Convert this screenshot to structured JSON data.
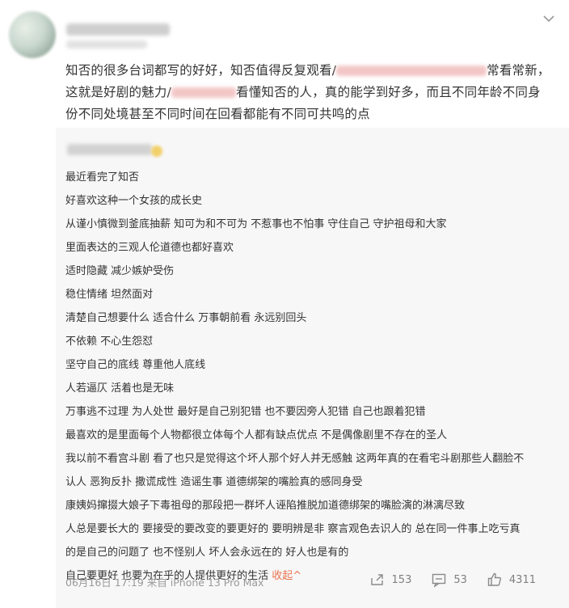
{
  "post": {
    "text_part1": "知否的很多台词都写的好好，知否值得反复观看/",
    "text_part2": "常看常新，",
    "text_part3": "这就是好剧的魅力/",
    "text_part4": "看懂知否的人，真的能学到好多，而且不同年龄不同身",
    "text_part5": "份不同处境甚至不同时间在回看都能有不同可共鸣的点"
  },
  "comment": {
    "lines": [
      "最近看完了知否",
      "好喜欢这种一个女孩的成长史",
      "从谨小慎微到釜底抽薪 知可为和不可为 不惹事也不怕事 守住自己 守护祖母和大家",
      "里面表达的三观人伦道德也都好喜欢",
      "适时隐藏 减少嫉妒受伤",
      "稳住情绪 坦然面对",
      "清楚自己想要什么 适合什么 万事朝前看 永远别回头",
      "不依赖 不心生怨怼",
      "坚守自己的底线 尊重他人底线",
      "人若逼仄 活着也是无味",
      "万事逃不过理 为人处世 最好是自己别犯错 也不要因旁人犯错 自己也跟着犯错",
      "最喜欢的是里面每个人物都很立体每个人都有缺点优点 不是偶像剧里不存在的圣人",
      "我以前不看宫斗剧 看了也只是觉得这个坏人那个好人并无感触 这两年真的在看宅斗剧那些人翻脸不",
      "认人 恶狗反扑 撒谎成性 造谣生事 道德绑架的嘴脸真的感同身受",
      "康姨妈撺掇大娘子下毒祖母的那段把一群坏人诬陷推脱加道德绑架的嘴脸演的淋漓尽致",
      "人总是要长大的 要接受的要改变的要更好的 要明辨是非 察言观色去识人的 总在同一件事上吃亏真",
      "的是自己的问题了 也不怪别人 坏人会永远在的 好人也是有的"
    ],
    "last_line": "自己要更好 也要为在乎的人提供更好的生活",
    "collapse_label": "收起^",
    "meta": "06月16日 17:19 来自 iPhone 13 Pro Max",
    "repost_count": "153",
    "comment_count": "53",
    "like_count": "4311"
  },
  "icons": {
    "menu": "chevron-down-icon",
    "repost": "repost-icon",
    "comment": "comment-icon",
    "like": "thumbs-up-icon"
  }
}
